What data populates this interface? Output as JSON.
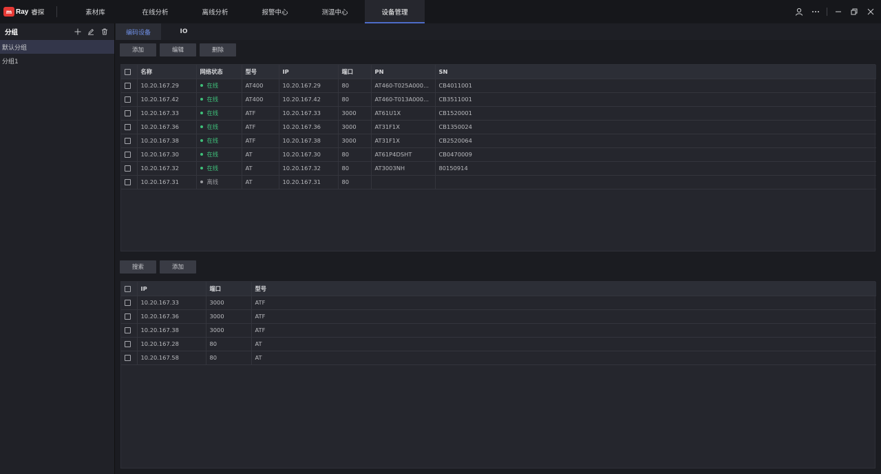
{
  "app": {
    "logo_mark": "m",
    "logo_text": "Ray",
    "logo_cn": "睿探"
  },
  "nav": [
    {
      "label": "素材库",
      "active": false
    },
    {
      "label": "在线分析",
      "active": false
    },
    {
      "label": "离线分析",
      "active": false
    },
    {
      "label": "报警中心",
      "active": false
    },
    {
      "label": "测温中心",
      "active": false
    },
    {
      "label": "设备管理",
      "active": true
    }
  ],
  "window_icons": [
    "user-icon",
    "more-icon",
    "minimize-icon",
    "restore-icon",
    "close-icon"
  ],
  "sidebar": {
    "title": "分组",
    "actions": [
      "add-icon",
      "edit-icon",
      "delete-icon"
    ],
    "items": [
      {
        "label": "默认分组",
        "active": true
      },
      {
        "label": "分组1",
        "active": false
      }
    ]
  },
  "tabs": [
    {
      "label": "编码设备",
      "active": true
    },
    {
      "label": "IO",
      "active": false
    }
  ],
  "device_toolbar": {
    "add": "添加",
    "edit": "编辑",
    "delete": "删除"
  },
  "device_table": {
    "columns": [
      "名称",
      "网络状态",
      "型号",
      "IP",
      "端口",
      "PN",
      "SN"
    ],
    "rows": [
      {
        "name": "10.20.167.29",
        "status": "在线",
        "online": true,
        "model": "AT400",
        "ip": "10.20.167.29",
        "port": "80",
        "pn": "AT460-T025A000...",
        "sn": "CB4011001"
      },
      {
        "name": "10.20.167.42",
        "status": "在线",
        "online": true,
        "model": "AT400",
        "ip": "10.20.167.42",
        "port": "80",
        "pn": "AT460-T013A000...",
        "sn": "CB3511001"
      },
      {
        "name": "10.20.167.33",
        "status": "在线",
        "online": true,
        "model": "ATF",
        "ip": "10.20.167.33",
        "port": "3000",
        "pn": "AT61U1X",
        "sn": "CB1520001"
      },
      {
        "name": "10.20.167.36",
        "status": "在线",
        "online": true,
        "model": "ATF",
        "ip": "10.20.167.36",
        "port": "3000",
        "pn": "AT31F1X",
        "sn": "CB1350024"
      },
      {
        "name": "10.20.167.38",
        "status": "在线",
        "online": true,
        "model": "ATF",
        "ip": "10.20.167.38",
        "port": "3000",
        "pn": "AT31F1X",
        "sn": "CB2520064"
      },
      {
        "name": "10.20.167.30",
        "status": "在线",
        "online": true,
        "model": "AT",
        "ip": "10.20.167.30",
        "port": "80",
        "pn": "AT61P4DSHT",
        "sn": "CB0470009"
      },
      {
        "name": "10.20.167.32",
        "status": "在线",
        "online": true,
        "model": "AT",
        "ip": "10.20.167.32",
        "port": "80",
        "pn": "AT3003NH",
        "sn": "80150914"
      },
      {
        "name": "10.20.167.31",
        "status": "离线",
        "online": false,
        "model": "AT",
        "ip": "10.20.167.31",
        "port": "80",
        "pn": "",
        "sn": ""
      }
    ]
  },
  "search_toolbar": {
    "search": "搜索",
    "add": "添加"
  },
  "search_table": {
    "columns": [
      "IP",
      "端口",
      "型号"
    ],
    "rows": [
      {
        "ip": "10.20.167.33",
        "port": "3000",
        "model": "ATF"
      },
      {
        "ip": "10.20.167.36",
        "port": "3000",
        "model": "ATF"
      },
      {
        "ip": "10.20.167.38",
        "port": "3000",
        "model": "ATF"
      },
      {
        "ip": "10.20.167.28",
        "port": "80",
        "model": "AT"
      },
      {
        "ip": "10.20.167.58",
        "port": "80",
        "model": "AT"
      }
    ]
  },
  "colors": {
    "accent": "#4d6cc9",
    "online": "#3fc07a",
    "offline": "#9a9ba0"
  }
}
